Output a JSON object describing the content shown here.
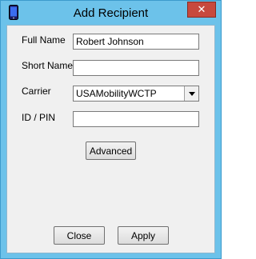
{
  "window": {
    "title": "Add Recipient",
    "close_glyph": "✕",
    "icon": "mobile-phone-icon"
  },
  "form": {
    "full_name": {
      "label": "Full Name",
      "value": "Robert Johnson"
    },
    "short_name": {
      "label": "Short Name",
      "value": ""
    },
    "carrier": {
      "label": "Carrier",
      "value": "USAMobilityWCTP"
    },
    "id_pin": {
      "label": "ID / PIN",
      "value": ""
    }
  },
  "buttons": {
    "advanced": "Advanced",
    "close": "Close",
    "apply": "Apply"
  },
  "colors": {
    "frame": "#6cc2ea",
    "close_button": "#c7493e",
    "client_bg": "#f0f0f0"
  }
}
